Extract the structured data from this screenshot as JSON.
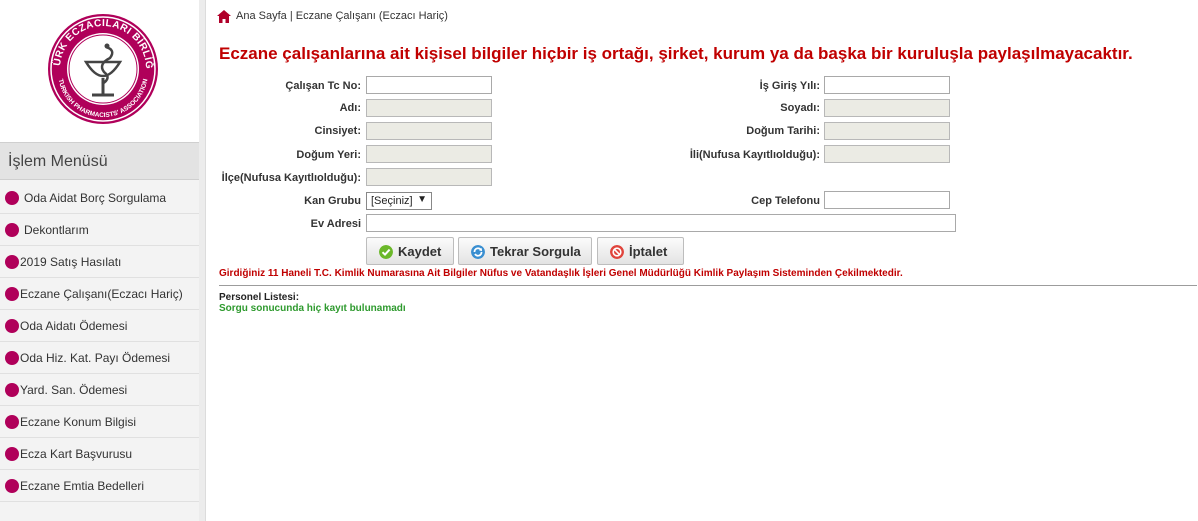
{
  "logo": {
    "top_text": "TÜRK ECZACILARI BİRLİĞİ",
    "bottom_text": "TURKISH PHARMACISTS' ASSOCIATION",
    "accent": "#b0005a"
  },
  "sidebar": {
    "title": "İşlem Menüsü",
    "items": [
      {
        "label": "Oda Aidat Borç Sorgulama"
      },
      {
        "label": "Dekontlarım"
      },
      {
        "label": "2019 Satış Hasılatı"
      },
      {
        "label": "Eczane Çalışanı(Eczacı Hariç)"
      },
      {
        "label": "Oda Aidatı Ödemesi"
      },
      {
        "label": "Oda Hiz. Kat. Payı Ödemesi"
      },
      {
        "label": "Yard. San. Ödemesi"
      },
      {
        "label": "Eczane Konum Bilgisi"
      },
      {
        "label": "Ecza Kart Başvurusu"
      },
      {
        "label": "Eczane Emtia Bedelleri"
      }
    ]
  },
  "breadcrumb": {
    "text": "Ana Sayfa | Eczane Çalışanı (Eczacı Hariç)"
  },
  "notice": "Eczane çalışanlarına ait kişisel bilgiler hiçbir iş ortağı, şirket, kurum ya da başka bir kuruluşla paylaşılmayacaktır.",
  "form": {
    "tc_label": "Çalışan Tc No:",
    "tc_value": "",
    "ad_label": "Adı:",
    "ad_value": "",
    "cinsiyet_label": "Cinsiyet:",
    "cinsiyet_value": "",
    "dogum_yeri_label": "Doğum Yeri:",
    "dogum_yeri_value": "",
    "ilce_label": "İlçe(Nufusa Kayıtlıolduğu):",
    "ilce_value": "",
    "kan_label": "Kan Grubu",
    "kan_selected": "[Seçiniz]",
    "ev_label": "Ev Adresi",
    "ev_value": "",
    "giris_label": "İş Giriş Yılı:",
    "giris_value": "",
    "soyad_label": "Soyadı:",
    "soyad_value": "",
    "dogum_tarihi_label": "Doğum Tarihi:",
    "dogum_tarihi_value": "",
    "il_label": "İli(Nufusa Kayıtlıolduğu):",
    "il_value": "",
    "cep_label": "Cep Telefonu",
    "cep_value": ""
  },
  "buttons": {
    "save": "Kaydet",
    "requery": "Tekrar Sorgula",
    "cancel": "İptalet"
  },
  "info": "Girdiğiniz 11 Haneli T.C. Kimlik Numarasına Ait Bilgiler Nüfus ve Vatandaşlık İşleri Genel Müdürlüğü Kimlik Paylaşım Sisteminden Çekilmektedir.",
  "personel": {
    "title": "Personel Listesi:",
    "empty": "Sorgu sonucunda hiç kayıt bulunamadı"
  },
  "colors": {
    "notice_red": "#c00000",
    "success_green": "#2e9a2e",
    "menu_bullet": "#b0005a"
  }
}
